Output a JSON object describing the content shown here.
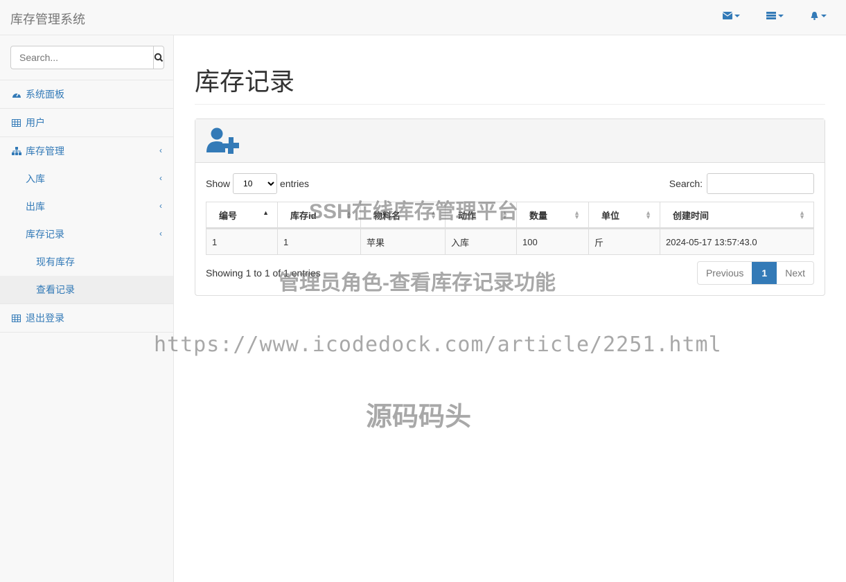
{
  "header": {
    "brand": "库存管理系统",
    "icons": [
      "envelope-icon",
      "tasks-icon",
      "bell-icon"
    ]
  },
  "sidebar": {
    "search_placeholder": "Search...",
    "items": [
      {
        "label": "系统面板",
        "icon": "dashboard-icon"
      },
      {
        "label": "用户",
        "icon": "table-icon"
      },
      {
        "label": "库存管理",
        "icon": "sitemap-icon"
      },
      {
        "label": "入库"
      },
      {
        "label": "出库"
      },
      {
        "label": "库存记录"
      },
      {
        "label": "现有库存"
      },
      {
        "label": "查看记录"
      },
      {
        "label": "退出登录",
        "icon": "table-icon"
      }
    ]
  },
  "main": {
    "title": "库存记录",
    "panel_icon": "user-plus-icon",
    "show_label": "Show",
    "entries_label": "entries",
    "page_size": "10",
    "search_label": "Search:",
    "columns": [
      "编号",
      "库存id",
      "物料名",
      "动作",
      "数量",
      "单位",
      "创建时间"
    ],
    "rows": [
      [
        "1",
        "1",
        "苹果",
        "入库",
        "100",
        "斤",
        "2024-05-17 13:57:43.0"
      ]
    ],
    "info": "Showing 1 to 1 of 1 entries",
    "pagination": {
      "previous": "Previous",
      "current": "1",
      "next": "Next"
    }
  },
  "watermarks": [
    "SSH在线库存管理平台",
    "管理员角色-查看库存记录功能",
    "https://www.icodedock.com/article/2251.html",
    "源码码头"
  ],
  "colors": {
    "accent": "#337ab7"
  }
}
